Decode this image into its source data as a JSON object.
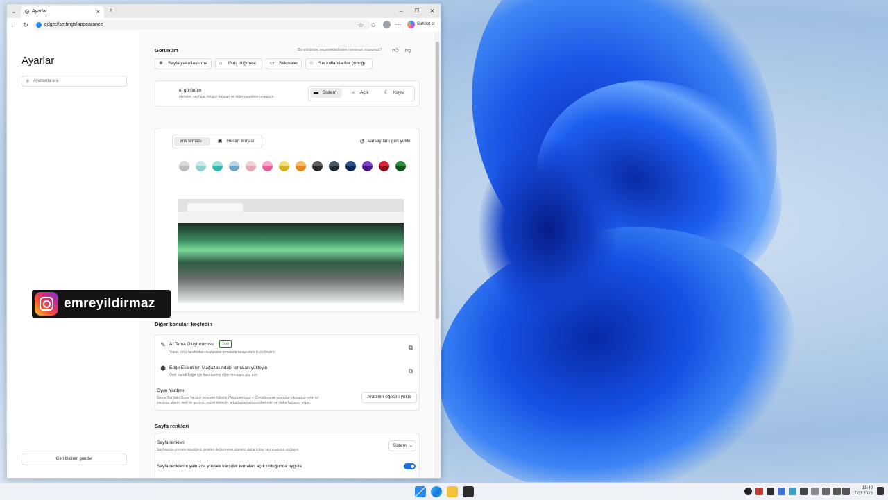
{
  "browser": {
    "tab_title": "Ayarlar",
    "url": "edge://settings/appearance",
    "copilot_label": "Sohbet et",
    "window_controls": [
      "minimize-icon",
      "maximize-icon",
      "close-icon"
    ]
  },
  "sidebar": {
    "title": "Ayarlar",
    "search_placeholder": "Ayarlarda ara",
    "feedback_button": "Geri bildirim gönder"
  },
  "appearance": {
    "heading": "Görünüm",
    "feedback_question": "Bu görünüm seçeneklerinden memnun musunuz?",
    "chips": [
      {
        "label": "Sayfa yakınlaştırma",
        "icon": "zoom-icon"
      },
      {
        "label": "Giriş düğmesi",
        "icon": "home-icon"
      },
      {
        "label": "Sekmeler",
        "icon": "tabs-icon"
      },
      {
        "label": "Sık kullanılanlar çubuğu",
        "icon": "star-icon"
      }
    ],
    "overall_title": "el görünüm",
    "overall_desc": "ekmeler, sayfalar, iletişim kutuları ve diğer menülere uygulanır",
    "mode_options": [
      {
        "label": "Sistem",
        "icon": "monitor-icon",
        "selected": true
      },
      {
        "label": "Açık",
        "icon": "sun-icon",
        "selected": false
      },
      {
        "label": "Koyu",
        "icon": "moon-icon",
        "selected": false
      }
    ],
    "theme_tabs": [
      {
        "label": "enk teması",
        "selected": true
      },
      {
        "label": "Resim teması",
        "selected": false
      }
    ],
    "reset_label": "Varsayılanı geri yükle",
    "swatches": [
      {
        "top": "#d9d9d9",
        "bottom": "#bdbdbd"
      },
      {
        "top": "#cde9ea",
        "bottom": "#8fcfd0"
      },
      {
        "top": "#9fe3d8",
        "bottom": "#2fb8a8"
      },
      {
        "top": "#bcd4e6",
        "bottom": "#6fa3cc"
      },
      {
        "top": "#f4d2d6",
        "bottom": "#e8aab2"
      },
      {
        "top": "#f7a6c9",
        "bottom": "#e55e9a"
      },
      {
        "top": "#f2dd7a",
        "bottom": "#d4b01e"
      },
      {
        "top": "#f5b967",
        "bottom": "#e48a1d"
      },
      {
        "top": "#5e5e5e",
        "bottom": "#2b2b2b"
      },
      {
        "top": "#4a5563",
        "bottom": "#1f2833"
      },
      {
        "top": "#2a4e86",
        "bottom": "#0d2a57"
      },
      {
        "top": "#7b42c8",
        "bottom": "#4a1791"
      },
      {
        "top": "#d62235",
        "bottom": "#8e0d1a"
      },
      {
        "top": "#2e8a3a",
        "bottom": "#11561d"
      }
    ]
  },
  "explore": {
    "heading": "Diğer konuları keşfedin",
    "items": [
      {
        "title": "AI Tema Oluşturucusu",
        "badge": "Yeni",
        "desc": "Yapay zeka tarafından oluşturulan temalarla tarayıcınızı kişiselleştirin"
      },
      {
        "title": "Edge Eklentileri Mağazasındaki temaları yükleyin",
        "desc": "Özel olarak Edge için hazırlanmış diğer temalara göz atın"
      }
    ],
    "game_title": "Oyun Yardımı",
    "game_desc1": "Game Bar'daki Oyun Yardımı pencere öğesini (Windows tuşu + G) kullanarak oyundan çıkmadan oyun içi",
    "game_desc2": "yardıma ulaşın, web'de gezinin, müzik dinleyin, arkadaşlarınızla sohbet edin ve daha fazlasını yapın.",
    "game_button": "Arabirim öğesini yükle"
  },
  "page_colors": {
    "heading": "Sayfa renkleri",
    "row_title": "Sayfa renkleri",
    "row_desc": "Sayfalarda görmek istediğiniz renkleri değiştirerek sitelerin daha kolay okunmasının sağlayın",
    "select_value": "Sistem",
    "toggle_label": "Sayfa renklerini yalnızca yüksek karşıtlık temaları açık olduğunda uygula",
    "toggle_on": true
  },
  "overlay": {
    "instagram_handle": "emreyildirmaz"
  },
  "taskbar": {
    "time": "15:40",
    "date": "17.03.2026"
  }
}
